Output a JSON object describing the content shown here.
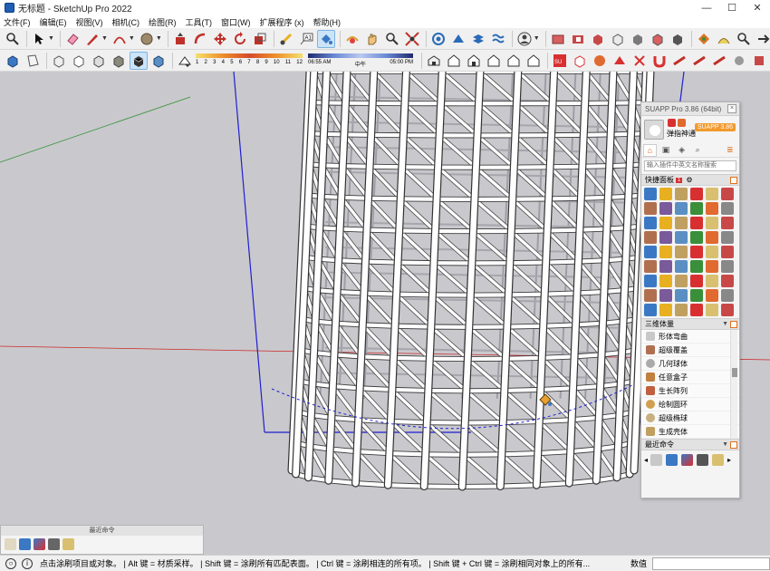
{
  "window": {
    "title": "无标题 - SketchUp Pro 2022",
    "minimize": "—",
    "maximize": "☐",
    "close": "✕"
  },
  "menu": [
    "文件(F)",
    "编辑(E)",
    "视图(V)",
    "相机(C)",
    "绘图(R)",
    "工具(T)",
    "窗口(W)",
    "扩展程序 (x)",
    "帮助(H)"
  ],
  "shadow": {
    "months": [
      "1",
      "2",
      "3",
      "4",
      "5",
      "6",
      "7",
      "8",
      "9",
      "10",
      "11",
      "12"
    ],
    "time_start": "06:55 AM",
    "time_mid": "中午",
    "time_end": "05:00 PM"
  },
  "suapp": {
    "header": "SUAPP Pro 3.86 (64bit)",
    "user": "弹指神通",
    "version_badge": "SUAPP 3.86",
    "search_placeholder": "输入插件中英文名称搜索",
    "quick_panel": "快捷面板",
    "quick_panel_num": "1",
    "section_3d": "三维体量",
    "plugins": [
      "形体弯曲",
      "超级覆盖",
      "几何球体",
      "任意盒子",
      "生长阵列",
      "绘制圆环",
      "超级椭球",
      "生成壳体"
    ],
    "recent_title": "最近命令"
  },
  "recent_float_title": "最近命令",
  "status": {
    "text": "点击涂刷项目或对象。 | Alt 键 = 材质采样。 | Shift 键 = 涂刷所有匹配表面。 | Ctrl 键 = 涂刷相连的所有项。 | Shift 键 + Ctrl 键 = 涂刷相同对象上的所有...",
    "measure_label": "数值",
    "measure_value": ""
  },
  "colors": {
    "viewport_bg": "#c9c8cd",
    "axis_blue": "#2222cc",
    "axis_red": "#cc2222",
    "axis_green": "#228822",
    "accent_orange": "#f29a2e"
  }
}
